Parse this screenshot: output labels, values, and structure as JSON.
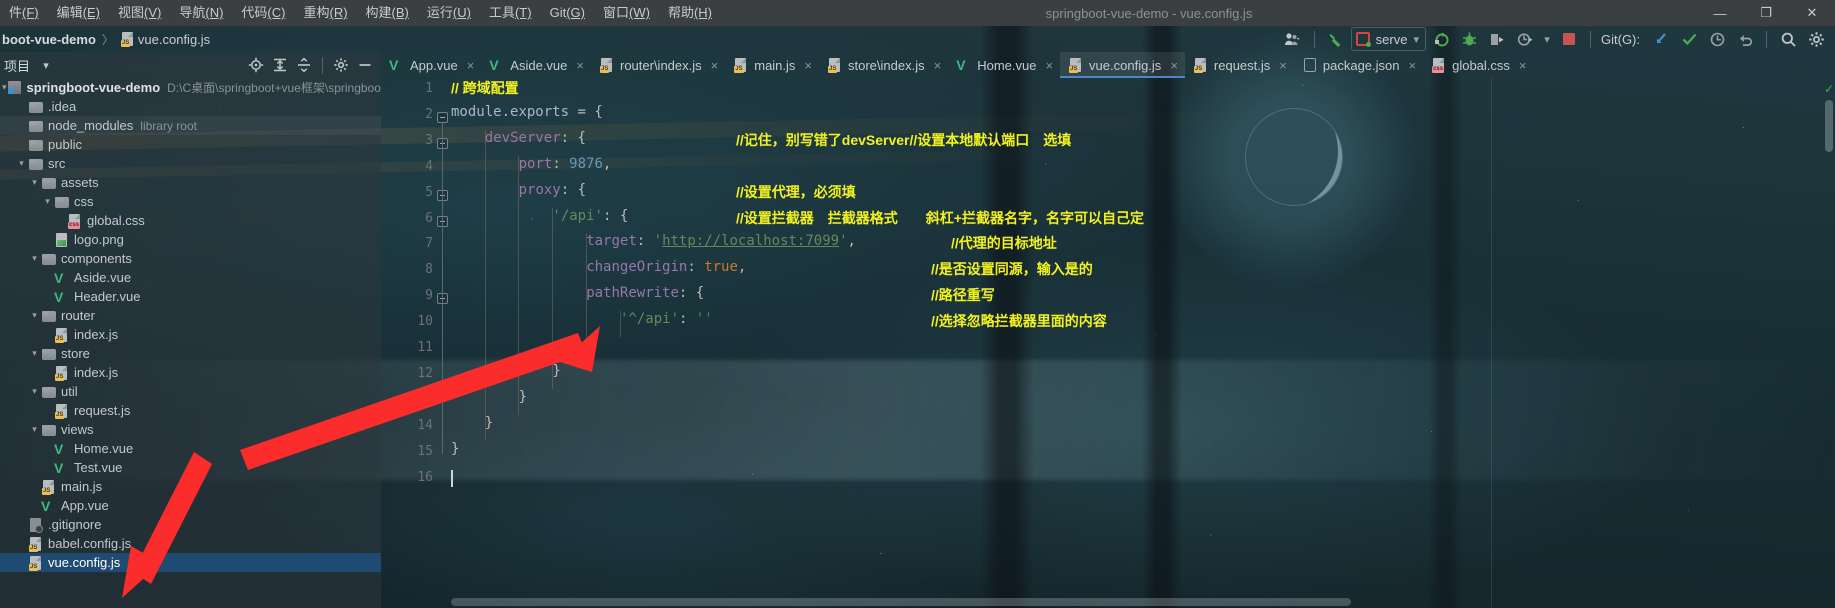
{
  "window": {
    "title": "springboot-vue-demo - vue.config.js",
    "controls": {
      "minimize": "—",
      "maximize": "❐",
      "close": "✕"
    }
  },
  "menubar": {
    "items": [
      {
        "label": "件",
        "mnemonic": "(F)"
      },
      {
        "label": "编辑",
        "mnemonic": "(E)"
      },
      {
        "label": "视图",
        "mnemonic": "(V)"
      },
      {
        "label": "导航",
        "mnemonic": "(N)"
      },
      {
        "label": "代码",
        "mnemonic": "(C)"
      },
      {
        "label": "重构",
        "mnemonic": "(R)"
      },
      {
        "label": "构建",
        "mnemonic": "(B)"
      },
      {
        "label": "运行",
        "mnemonic": "(U)"
      },
      {
        "label": "工具",
        "mnemonic": "(T)"
      },
      {
        "label": "Git",
        "mnemonic": "(G)"
      },
      {
        "label": "窗口",
        "mnemonic": "(W)"
      },
      {
        "label": "帮助",
        "mnemonic": "(H)"
      }
    ]
  },
  "navbar": {
    "crumbs": [
      {
        "label": "boot-vue-demo",
        "icon": "none"
      },
      {
        "label": "vue.config.js",
        "icon": "js-file-icon"
      }
    ],
    "separator": "〉",
    "run_config": {
      "name": "serve",
      "dropdown": "▾"
    },
    "git_label": "Git(G):",
    "icons": [
      "user-avatar-icon",
      "hammer-build-icon",
      "run-icon",
      "debug-icon",
      "run-with-coverage-icon",
      "profiler-icon",
      "stop-icon",
      "git-update-icon",
      "git-commit-icon",
      "git-history-icon",
      "git-rollback-icon",
      "search-icon",
      "settings-icon"
    ]
  },
  "project_tool": {
    "title": "项目",
    "dropdown": "▾",
    "header_icons": [
      "locate-icon",
      "expand-all-icon",
      "collapse-all-icon",
      "gear-icon",
      "hide-icon"
    ],
    "tree": [
      {
        "indent": 0,
        "arrow": "down",
        "icon": "module-icon",
        "label": "springboot-vue-demo",
        "bold": true,
        "note": "D:\\C桌面\\springboot+vue框架\\springboot-vue-dem"
      },
      {
        "indent": 1,
        "arrow": "none",
        "icon": "folder-icon",
        "label": ".idea",
        "bold": false,
        "note": ""
      },
      {
        "indent": 1,
        "arrow": "none",
        "icon": "folder-icon",
        "label": "node_modules",
        "bold": false,
        "note": "library root"
      },
      {
        "indent": 1,
        "arrow": "none",
        "icon": "folder-icon",
        "label": "public",
        "bold": false,
        "note": ""
      },
      {
        "indent": 1,
        "arrow": "down",
        "icon": "folder-icon",
        "label": "src",
        "bold": false,
        "note": ""
      },
      {
        "indent": 2,
        "arrow": "down",
        "icon": "folder-icon",
        "label": "assets",
        "bold": false,
        "note": ""
      },
      {
        "indent": 3,
        "arrow": "down",
        "icon": "folder-icon",
        "label": "css",
        "bold": false,
        "note": ""
      },
      {
        "indent": 4,
        "arrow": "none",
        "icon": "css-file-icon",
        "label": "global.css",
        "bold": false,
        "note": ""
      },
      {
        "indent": 3,
        "arrow": "none",
        "icon": "image-file-icon",
        "label": "logo.png",
        "bold": false,
        "note": ""
      },
      {
        "indent": 2,
        "arrow": "down",
        "icon": "folder-icon",
        "label": "components",
        "bold": false,
        "note": ""
      },
      {
        "indent": 3,
        "arrow": "none",
        "icon": "vue-file-icon",
        "label": "Aside.vue",
        "bold": false,
        "note": ""
      },
      {
        "indent": 3,
        "arrow": "none",
        "icon": "vue-file-icon",
        "label": "Header.vue",
        "bold": false,
        "note": ""
      },
      {
        "indent": 2,
        "arrow": "down",
        "icon": "folder-icon",
        "label": "router",
        "bold": false,
        "note": ""
      },
      {
        "indent": 3,
        "arrow": "none",
        "icon": "js-file-icon",
        "label": "index.js",
        "bold": false,
        "note": ""
      },
      {
        "indent": 2,
        "arrow": "down",
        "icon": "folder-icon",
        "label": "store",
        "bold": false,
        "note": ""
      },
      {
        "indent": 3,
        "arrow": "none",
        "icon": "js-file-icon",
        "label": "index.js",
        "bold": false,
        "note": ""
      },
      {
        "indent": 2,
        "arrow": "down",
        "icon": "folder-icon",
        "label": "util",
        "bold": false,
        "note": ""
      },
      {
        "indent": 3,
        "arrow": "none",
        "icon": "js-file-icon",
        "label": "request.js",
        "bold": false,
        "note": ""
      },
      {
        "indent": 2,
        "arrow": "down",
        "icon": "folder-icon",
        "label": "views",
        "bold": false,
        "note": ""
      },
      {
        "indent": 3,
        "arrow": "none",
        "icon": "vue-file-icon",
        "label": "Home.vue",
        "bold": false,
        "note": ""
      },
      {
        "indent": 3,
        "arrow": "none",
        "icon": "vue-file-icon",
        "label": "Test.vue",
        "bold": false,
        "note": ""
      },
      {
        "indent": 2,
        "arrow": "none",
        "icon": "js-file-icon",
        "label": "main.js",
        "bold": false,
        "note": ""
      },
      {
        "indent": 2,
        "arrow": "none",
        "icon": "vue-file-icon",
        "label": "App.vue",
        "bold": false,
        "note": ""
      },
      {
        "indent": 1,
        "arrow": "none",
        "icon": "gitignore-file-icon",
        "label": ".gitignore",
        "bold": false,
        "note": ""
      },
      {
        "indent": 1,
        "arrow": "none",
        "icon": "js-file-icon",
        "label": "babel.config.js",
        "bold": false,
        "note": ""
      },
      {
        "indent": 1,
        "arrow": "none",
        "icon": "js-file-icon",
        "label": "vue.config.js",
        "bold": false,
        "note": "",
        "selected": true
      }
    ]
  },
  "editor": {
    "tabs": [
      {
        "label": "App.vue",
        "icon": "vue-file-icon",
        "active": false,
        "close": "×"
      },
      {
        "label": "Aside.vue",
        "icon": "vue-file-icon",
        "active": false,
        "close": "×"
      },
      {
        "label": "router\\index.js",
        "icon": "js-file-icon",
        "active": false,
        "close": "×"
      },
      {
        "label": "main.js",
        "icon": "js-file-icon",
        "active": false,
        "close": "×"
      },
      {
        "label": "store\\index.js",
        "icon": "js-file-icon",
        "active": false,
        "close": "×"
      },
      {
        "label": "Home.vue",
        "icon": "vue-file-icon",
        "active": false,
        "close": "×"
      },
      {
        "label": "vue.config.js",
        "icon": "js-file-icon",
        "active": true,
        "close": "×"
      },
      {
        "label": "request.js",
        "icon": "js-file-icon",
        "active": false,
        "close": "×"
      },
      {
        "label": "package.json",
        "icon": "json-file-icon",
        "active": false,
        "close": "×"
      },
      {
        "label": "global.css",
        "icon": "css-file-icon",
        "active": false,
        "close": "×"
      }
    ],
    "line_numbers": [
      "1",
      "2",
      "3",
      "4",
      "5",
      "6",
      "7",
      "8",
      "9",
      "10",
      "11",
      "12",
      "13",
      "14",
      "15",
      "16"
    ],
    "lines": [
      {
        "n": 1,
        "indent": 0,
        "code": "// 跨域配置",
        "kind": "comment"
      },
      {
        "n": 2,
        "indent": 0,
        "code": "module.exports = {",
        "kind": "code"
      },
      {
        "n": 3,
        "indent": 1,
        "code": "devServer: {",
        "kind": "code"
      },
      {
        "n": 4,
        "indent": 2,
        "code": "port: 9876,",
        "kind": "code"
      },
      {
        "n": 5,
        "indent": 2,
        "code": "proxy: {",
        "kind": "code"
      },
      {
        "n": 6,
        "indent": 3,
        "code": "'/api': {",
        "kind": "code"
      },
      {
        "n": 7,
        "indent": 4,
        "code": "target: 'http://localhost:7099',",
        "kind": "code"
      },
      {
        "n": 8,
        "indent": 4,
        "code": "changeOrigin: true,",
        "kind": "code"
      },
      {
        "n": 9,
        "indent": 4,
        "code": "pathRewrite: {",
        "kind": "code"
      },
      {
        "n": 10,
        "indent": 5,
        "code": "'^/api': ''",
        "kind": "code"
      },
      {
        "n": 11,
        "indent": 4,
        "code": "}",
        "kind": "code"
      },
      {
        "n": 12,
        "indent": 3,
        "code": "}",
        "kind": "code"
      },
      {
        "n": 13,
        "indent": 2,
        "code": "}",
        "kind": "code"
      },
      {
        "n": 14,
        "indent": 1,
        "code": "}",
        "kind": "code"
      },
      {
        "n": 15,
        "indent": 0,
        "code": "}",
        "kind": "code"
      },
      {
        "n": 16,
        "indent": 0,
        "code": "",
        "kind": "code"
      }
    ],
    "annotations": [
      {
        "text": "//记住，别写错了devServer//设置本地默认端口　选填",
        "line": 3
      },
      {
        "text": "//设置代理，必须填",
        "line": 5
      },
      {
        "text": "//设置拦截器　拦截器格式　　斜杠+拦截器名字，名字可以自己定",
        "line": 6
      },
      {
        "text": "//代理的目标地址",
        "line": 7
      },
      {
        "text": "//是否设置同源，输入是的",
        "line": 8
      },
      {
        "text": "//路径重写",
        "line": 9
      },
      {
        "text": "//选择忽略拦截器里面的内容",
        "line": 10
      }
    ]
  },
  "colors": {
    "comment_yellow": "#f2f21f",
    "selection_blue": "#1f4a72",
    "accent_blue": "#4a88c7",
    "vue_green": "#41b883",
    "js_badge": "#e8bf5a",
    "css_badge": "#f08a98",
    "annotation_red": "#fb2c2c",
    "run_green": "#3fae49",
    "stop_red": "#c75450"
  }
}
